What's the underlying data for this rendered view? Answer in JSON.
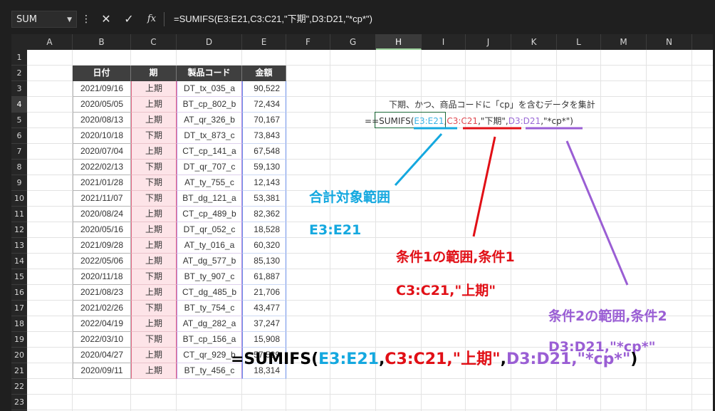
{
  "formula_bar": {
    "name_box": "SUM",
    "cancel_icon": "✕",
    "enter_icon": "✓",
    "fx_icon": "fx",
    "formula": "=SUMIFS(E3:E21,C3:C21,\"下期\",D3:D21,\"*cp*\")"
  },
  "columns": [
    "A",
    "B",
    "C",
    "D",
    "E",
    "F",
    "G",
    "H",
    "I",
    "J",
    "K",
    "L",
    "M",
    "N"
  ],
  "active_column": "H",
  "rows": [
    "1",
    "2",
    "3",
    "4",
    "5",
    "6",
    "7",
    "8",
    "9",
    "10",
    "11",
    "12",
    "13",
    "14",
    "15",
    "16",
    "17",
    "18",
    "19",
    "20",
    "21",
    "22",
    "23"
  ],
  "active_row": "4",
  "table": {
    "headers": [
      "日付",
      "期",
      "製品コード",
      "金額"
    ],
    "rows": [
      [
        "2021/09/16",
        "上期",
        "DT_tx_035_a",
        "90,522"
      ],
      [
        "2020/05/05",
        "上期",
        "BT_cp_802_b",
        "72,434"
      ],
      [
        "2020/08/13",
        "上期",
        "AT_qr_326_b",
        "70,167"
      ],
      [
        "2020/10/18",
        "下期",
        "DT_tx_873_c",
        "73,843"
      ],
      [
        "2020/07/04",
        "上期",
        "CT_cp_141_a",
        "67,548"
      ],
      [
        "2022/02/13",
        "下期",
        "DT_qr_707_c",
        "59,130"
      ],
      [
        "2021/01/28",
        "下期",
        "AT_ty_755_c",
        "12,143"
      ],
      [
        "2021/11/07",
        "下期",
        "BT_dg_121_a",
        "53,381"
      ],
      [
        "2020/08/24",
        "上期",
        "CT_cp_489_b",
        "82,362"
      ],
      [
        "2020/05/16",
        "上期",
        "DT_qr_052_c",
        "18,528"
      ],
      [
        "2021/09/28",
        "上期",
        "AT_ty_016_a",
        "60,320"
      ],
      [
        "2022/05/06",
        "上期",
        "AT_dg_577_b",
        "85,130"
      ],
      [
        "2020/11/18",
        "下期",
        "BT_ty_907_c",
        "61,887"
      ],
      [
        "2021/08/23",
        "上期",
        "CT_dg_485_b",
        "21,706"
      ],
      [
        "2021/02/26",
        "下期",
        "BT_ty_754_c",
        "43,477"
      ],
      [
        "2022/04/19",
        "上期",
        "AT_dg_282_a",
        "37,247"
      ],
      [
        "2022/03/10",
        "下期",
        "BT_cp_156_a",
        "15,908"
      ],
      [
        "2020/04/27",
        "上期",
        "CT_qr_929_b",
        "57,539"
      ],
      [
        "2020/09/11",
        "上期",
        "BT_ty_456_c",
        "18,314"
      ]
    ]
  },
  "annotation": {
    "description": "下期、かつ、商品コードに「cp」を含むデータを集計",
    "cell_formula": {
      "prefix": "=",
      "fn": "=SUMIFS(",
      "p1": "E3:E21",
      "c1": ",",
      "p2": "C3:C21",
      "p3": ",\"下期\",",
      "p4": "D3:D21",
      "p5": ",\"*cp*\")"
    },
    "label_sum_range_title": "合計対象範囲",
    "label_sum_range": "E3:E21",
    "label_cond1_title": "条件1の範囲,条件1",
    "label_cond1": "C3:C21,\"上期\"",
    "label_cond2_title": "条件2の範囲,条件2",
    "label_cond2": "D3:D21,\"*cp*\""
  },
  "big_formula": {
    "a": "=SUMIFS(",
    "b": "E3:E21",
    "c": ",",
    "d": "C3:C21,\"上期\"",
    "e": ",",
    "f": "D3:D21,\"*cp*\"",
    "g": ")"
  },
  "colors": {
    "blue": "#14a8df",
    "red": "#e10f16",
    "purple": "#9a5ed4"
  }
}
